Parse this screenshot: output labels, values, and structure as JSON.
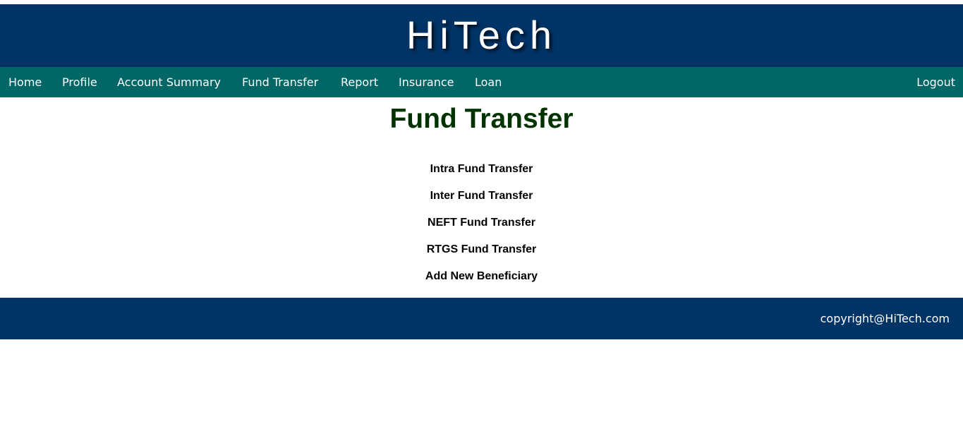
{
  "header": {
    "brand": "HiTech"
  },
  "nav": {
    "items": [
      {
        "label": "Home"
      },
      {
        "label": "Profile"
      },
      {
        "label": "Account Summary"
      },
      {
        "label": "Fund Transfer"
      },
      {
        "label": "Report"
      },
      {
        "label": "Insurance"
      },
      {
        "label": "Loan"
      }
    ],
    "logout": "Logout"
  },
  "main": {
    "title": "Fund Transfer",
    "links": [
      {
        "label": "Intra Fund Transfer"
      },
      {
        "label": "Inter Fund Transfer"
      },
      {
        "label": "NEFT Fund Transfer"
      },
      {
        "label": "RTGS Fund Transfer"
      },
      {
        "label": "Add New Beneficiary"
      }
    ]
  },
  "footer": {
    "copyright": "copyright@HiTech.com"
  },
  "colors": {
    "header_bg": "#003366",
    "nav_bg": "#006666",
    "title_color": "#003300"
  }
}
